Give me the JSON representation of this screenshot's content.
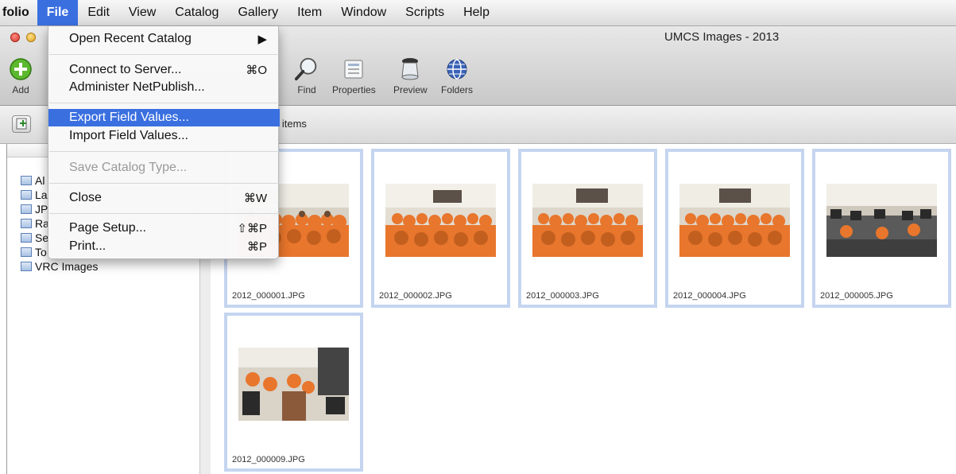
{
  "menubar": {
    "app": "folio",
    "items": [
      "File",
      "Edit",
      "View",
      "Catalog",
      "Gallery",
      "Item",
      "Window",
      "Scripts",
      "Help"
    ]
  },
  "window": {
    "title": "UMCS Images - 2013"
  },
  "toolbar": {
    "add": "Add",
    "find": "Find",
    "properties": "Properties",
    "preview": "Preview",
    "folders": "Folders"
  },
  "status": {
    "items_count": "1 items"
  },
  "sidebar": {
    "items": [
      {
        "label": "Al"
      },
      {
        "label": "La"
      },
      {
        "label": "JP"
      },
      {
        "label": "Ra"
      },
      {
        "label": "Se"
      },
      {
        "label": "To"
      },
      {
        "label": "VRC Images"
      }
    ]
  },
  "file_menu": {
    "items": [
      {
        "label": "Open Recent Catalog",
        "shortcut": "▶"
      },
      {
        "label": "Connect to Server...",
        "shortcut": "⌘O"
      },
      {
        "label": "Administer NetPublish...",
        "shortcut": ""
      },
      {
        "label": "Export Field Values...",
        "shortcut": ""
      },
      {
        "label": "Import Field Values...",
        "shortcut": ""
      },
      {
        "label": "Save Catalog Type...",
        "shortcut": ""
      },
      {
        "label": "Close",
        "shortcut": "⌘W"
      },
      {
        "label": "Page Setup...",
        "shortcut": "⇧⌘P"
      },
      {
        "label": "Print...",
        "shortcut": "⌘P"
      }
    ]
  },
  "grid": {
    "items": [
      {
        "filename": "2012_000001.JPG"
      },
      {
        "filename": "2012_000002.JPG"
      },
      {
        "filename": "2012_000003.JPG"
      },
      {
        "filename": "2012_000004.JPG"
      },
      {
        "filename": "2012_000005.JPG"
      },
      {
        "filename": "2012_000009.JPG"
      }
    ]
  },
  "colors": {
    "menu_highlight": "#3a6fe0",
    "cell_border": "#c5d5f0",
    "shirt_orange": "#e8762c"
  }
}
